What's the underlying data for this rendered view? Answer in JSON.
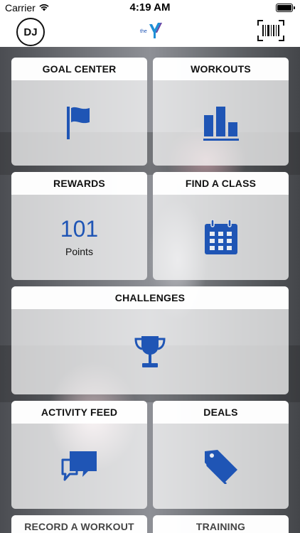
{
  "status_bar": {
    "carrier": "Carrier",
    "time": "4:19 AM"
  },
  "header": {
    "avatar_initials": "DJ",
    "logo": "ymca-logo",
    "barcode_icon": "barcode-icon"
  },
  "accent_color": "#1f55b5",
  "tiles": [
    {
      "title": "GOAL CENTER",
      "icon": "flag-icon"
    },
    {
      "title": "WORKOUTS",
      "icon": "bar-chart-icon"
    },
    {
      "title": "REWARDS",
      "points_value": "101",
      "points_label": "Points"
    },
    {
      "title": "FIND A CLASS",
      "icon": "calendar-icon"
    },
    {
      "title": "CHALLENGES",
      "icon": "trophy-icon"
    },
    {
      "title": "ACTIVITY FEED",
      "icon": "chat-bubbles-icon"
    },
    {
      "title": "DEALS",
      "icon": "price-tag-icon"
    },
    {
      "title": "RECORD A WORKOUT"
    },
    {
      "title": "TRAINING"
    }
  ]
}
